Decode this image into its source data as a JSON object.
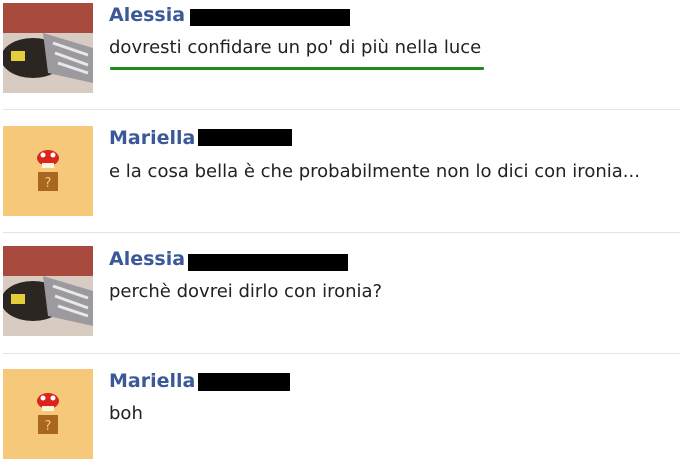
{
  "messages": [
    {
      "author": "Alessia",
      "text": "dovresti confidare un po' di più nella luce",
      "avatar": "shoes-photo"
    },
    {
      "author": "Mariella",
      "text": "e la cosa bella è che probabilmente non lo dici con ironia...",
      "avatar": "mushroom-block"
    },
    {
      "author": "Alessia",
      "text": "perchè dovrei dirlo con ironia?",
      "avatar": "shoes-photo"
    },
    {
      "author": "Mariella",
      "text": "boh",
      "avatar": "mushroom-block"
    }
  ],
  "colors": {
    "author_name": "#3b5998",
    "separator": "#e3e3e3",
    "highlight_underline": "#1f8a1f",
    "avatar_mushroom_bg": "#f6c879"
  }
}
